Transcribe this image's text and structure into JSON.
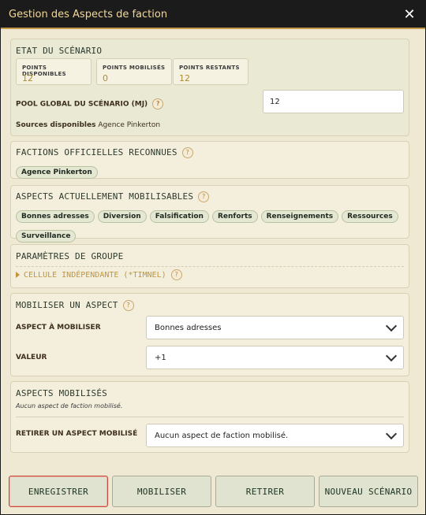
{
  "dialog": {
    "title": "Gestion des Aspects de faction",
    "close": "✕"
  },
  "scenario": {
    "title": "ETAT DU SCÉNARIO",
    "stats": [
      {
        "label": "POINTS DISPONIBLES",
        "value": "12"
      },
      {
        "label": "POINTS MOBILISÉS",
        "value": "0"
      },
      {
        "label": "POINTS RESTANTS",
        "value": "12"
      }
    ],
    "pool_label": "POOL GLOBAL DU SCÉNARIO (MJ)",
    "pool_value": "12",
    "sources_label": "Sources disponibles",
    "sources_value": "Agence Pinkerton"
  },
  "factions": {
    "title": "FACTIONS OFFICIELLES RECONNUES",
    "items": [
      "Agence Pinkerton"
    ]
  },
  "aspects": {
    "title": "ASPECTS ACTUELLEMENT MOBILISABLES",
    "items": [
      "Bonnes adresses",
      "Diversion",
      "Falsification",
      "Renforts",
      "Renseignements",
      "Ressources",
      "Surveillance"
    ]
  },
  "group": {
    "title": "PARAMÈTRES DE GROUPE",
    "cell_label": "CELLULE INDÉPENDANTE (*TIMNEL)"
  },
  "mobilize": {
    "title": "MOBILISER UN ASPECT",
    "aspect_label": "ASPECT À MOBILISER",
    "aspect_value": "Bonnes adresses",
    "value_label": "VALEUR",
    "value_value": "+1"
  },
  "mobilized": {
    "title": "ASPECTS MOBILISÉS",
    "empty_text": "Aucun aspect de faction mobilisé.",
    "remove_label": "RETIRER UN ASPECT MOBILISÉ",
    "remove_value": "Aucun aspect de faction mobilisé."
  },
  "footer": {
    "save": "ENREGISTRER",
    "mobilize": "MOBILISER",
    "remove": "RETIRER",
    "new_scenario": "NOUVEAU SCÉNARIO"
  },
  "help_glyph": "?"
}
